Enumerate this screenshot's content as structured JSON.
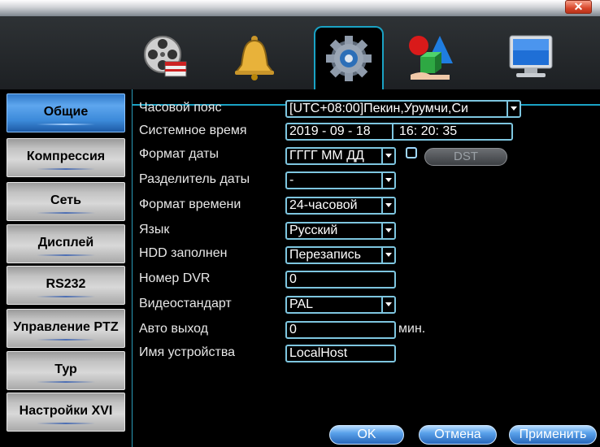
{
  "window": {
    "close_glyph": "✕"
  },
  "tabs": [
    {
      "name": "record",
      "icon": "film-reel-icon",
      "active": false
    },
    {
      "name": "alarm",
      "icon": "bell-icon",
      "active": false
    },
    {
      "name": "system",
      "icon": "gear-icon",
      "active": true
    },
    {
      "name": "tools",
      "icon": "shapes-icon",
      "active": false
    },
    {
      "name": "info",
      "icon": "monitor-icon",
      "active": false
    }
  ],
  "sidebar": {
    "items": [
      {
        "label": "Общие",
        "active": true
      },
      {
        "label": "Компрессия",
        "active": false
      },
      {
        "label": "Сеть",
        "active": false
      },
      {
        "label": "Дисплей",
        "active": false
      },
      {
        "label": "RS232",
        "active": false
      },
      {
        "label": "Управление PTZ",
        "active": false
      },
      {
        "label": "Тур",
        "active": false
      },
      {
        "label": "Настройки XVI",
        "active": false
      }
    ]
  },
  "form": {
    "timezone": {
      "label": "Часовой пояс",
      "value": "[UTC+08:00]Пекин,Урумчи,Си"
    },
    "system_time": {
      "label": "Системное время",
      "date": "2019 - 09 - 18",
      "time": "16: 20: 35"
    },
    "date_format": {
      "label": "Формат даты",
      "value": "ГГГГ ММ ДД",
      "dst_button": "DST"
    },
    "date_separator": {
      "label": "Разделитель даты",
      "value": "-"
    },
    "time_format": {
      "label": "Формат времени",
      "value": "24-часовой"
    },
    "language": {
      "label": "Язык",
      "value": "Русский"
    },
    "hdd_full": {
      "label": "HDD заполнен",
      "value": "Перезапись"
    },
    "dvr_number": {
      "label": "Номер DVR",
      "value": "0"
    },
    "video_standard": {
      "label": "Видеостандарт",
      "value": "PAL"
    },
    "auto_logout": {
      "label": "Авто выход",
      "value": "0",
      "unit": "мин."
    },
    "device_name": {
      "label": "Имя устройства",
      "value": "LocalHost"
    }
  },
  "footer": {
    "ok": "OK",
    "cancel": "Отмена",
    "apply": "Применить"
  },
  "colors": {
    "accent": "#1aa2c4",
    "field_border": "#7ec6e0",
    "active_tab": "#3c8ad9"
  }
}
